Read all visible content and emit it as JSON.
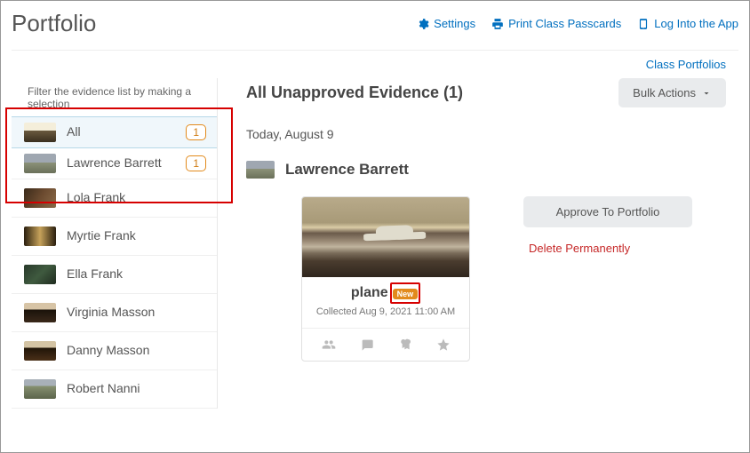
{
  "header": {
    "title": "Portfolio",
    "settings_label": "Settings",
    "print_label": "Print Class Passcards",
    "login_label": "Log Into the App"
  },
  "top_link": "Class Portfolios",
  "sidebar": {
    "filter_label": "Filter the evidence list by making a selection",
    "items": [
      {
        "label": "All",
        "count": "1"
      },
      {
        "label": "Lawrence Barrett",
        "count": "1"
      },
      {
        "label": "Lola Frank"
      },
      {
        "label": "Myrtie Frank"
      },
      {
        "label": "Ella Frank"
      },
      {
        "label": "Virginia Masson"
      },
      {
        "label": "Danny Masson"
      },
      {
        "label": "Robert Nanni"
      }
    ]
  },
  "main": {
    "title": "All Unapproved Evidence (1)",
    "bulk_label": "Bulk Actions",
    "date": "Today, August 9",
    "owner": "Lawrence Barrett",
    "card": {
      "title": "plane",
      "new_label": "New",
      "collected": "Collected Aug 9, 2021 11:00 AM"
    },
    "approve_label": "Approve To Portfolio",
    "delete_label": "Delete Permanently"
  }
}
